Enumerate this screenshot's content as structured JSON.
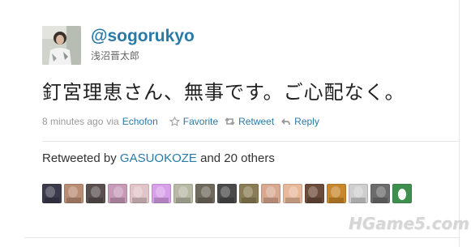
{
  "user": {
    "screen_name": "@sogorukyo",
    "full_name": "浅沼晋太郎"
  },
  "tweet": {
    "text": "釘宮理恵さん、無事です。ご心配なく。",
    "time": "8 minutes ago",
    "via_label": "via",
    "source": "Echofon"
  },
  "actions": {
    "favorite": "Favorite",
    "retweet": "Retweet",
    "reply": "Reply"
  },
  "retweeted": {
    "prefix": "Retweeted by",
    "user": "GASUOKOZE",
    "suffix": "and 20 others"
  },
  "retweeter_avatars": [
    {
      "color": "#3a3a4a"
    },
    {
      "color": "#b98c74"
    },
    {
      "color": "#5a5050"
    },
    {
      "color": "#c79ab8"
    },
    {
      "color": "#e0c4c8"
    },
    {
      "color": "#d8a0e8"
    },
    {
      "color": "#b7b9a4"
    },
    {
      "color": "#6f6a5c"
    },
    {
      "color": "#4a4a4a"
    },
    {
      "color": "#8a7d55"
    },
    {
      "color": "#d9a890"
    },
    {
      "color": "#e7b89a"
    },
    {
      "color": "#6b4b3a"
    },
    {
      "color": "#c9872c"
    },
    {
      "color": "#cfcfcf"
    },
    {
      "color": "#6c6c6c"
    },
    {
      "color": "#3f8f4f"
    }
  ],
  "watermark": "HGame5.com"
}
